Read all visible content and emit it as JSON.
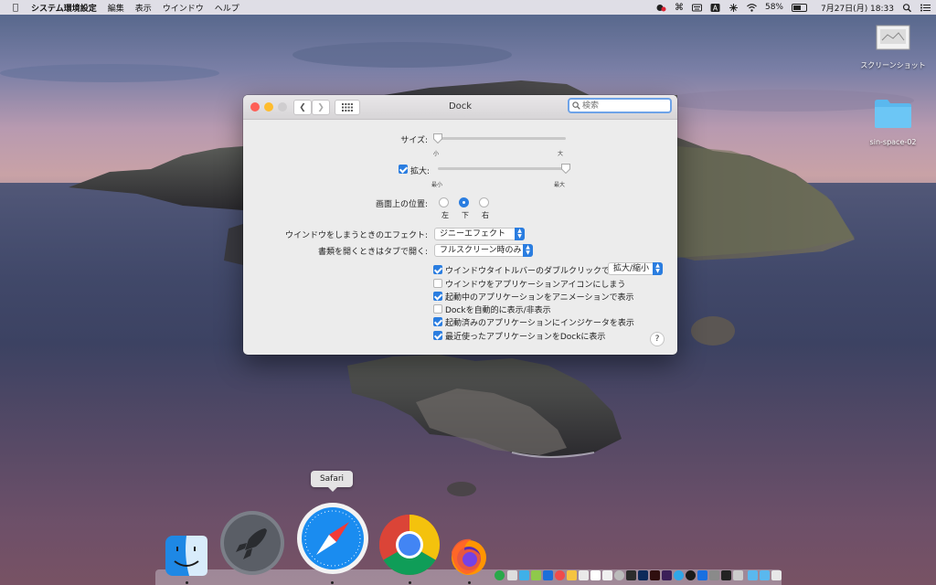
{
  "menubar": {
    "app_name": "システム環境設定",
    "menus": [
      "編集",
      "表示",
      "ウインドウ",
      "ヘルプ"
    ],
    "battery_percent": "58%",
    "battery_level": 0.58,
    "datetime": "7月27日(月)  18:33"
  },
  "desktop": {
    "icons": [
      {
        "label": "スクリーンショット",
        "icon": "screenshot-thumbnail-icon"
      },
      {
        "label": "sin-space-02",
        "icon": "folder-icon"
      }
    ]
  },
  "window": {
    "title": "Dock",
    "search_placeholder": "検索",
    "size": {
      "label": "サイズ:",
      "min_label": "小",
      "max_label": "大",
      "value": 0.0
    },
    "magnification": {
      "label": "拡大:",
      "checked": true,
      "min_label": "最小",
      "max_label": "最大",
      "value": 1.0
    },
    "position": {
      "label": "画面上の位置:",
      "options": [
        "左",
        "下",
        "右"
      ],
      "selected": "下"
    },
    "minimize_effect": {
      "label": "ウインドウをしまうときのエフェクト:",
      "value": "ジニーエフェクト"
    },
    "prefer_tabs": {
      "label": "書類を開くときはタブで開く:",
      "value": "フルスクリーン時のみ"
    },
    "double_click_action": {
      "label": "ウインドウタイトルバーのダブルクリックで",
      "checked": true,
      "value": "拡大/縮小"
    },
    "checkboxes": [
      {
        "label": "ウインドウをアプリケーションアイコンにしまう",
        "checked": false
      },
      {
        "label": "起動中のアプリケーションをアニメーションで表示",
        "checked": true
      },
      {
        "label": "Dockを自動的に表示/非表示",
        "checked": false
      },
      {
        "label": "起動済みのアプリケーションにインジケータを表示",
        "checked": true
      },
      {
        "label": "最近使ったアプリケーションをDockに表示",
        "checked": true
      }
    ],
    "help_label": "?"
  },
  "dock": {
    "tooltip": "Safari",
    "apps": [
      {
        "name": "Finder",
        "icon": "finder-icon"
      },
      {
        "name": "Launchpad",
        "icon": "launchpad-rocket-icon"
      },
      {
        "name": "Safari",
        "icon": "safari-compass-icon"
      },
      {
        "name": "Google Chrome",
        "icon": "chrome-icon"
      },
      {
        "name": "Firefox",
        "icon": "firefox-icon"
      }
    ]
  },
  "colors": {
    "accent": "#2a7de0",
    "close": "#fe5f57",
    "minimize": "#febc2e",
    "zoom_disabled": "#cfcdcf"
  }
}
